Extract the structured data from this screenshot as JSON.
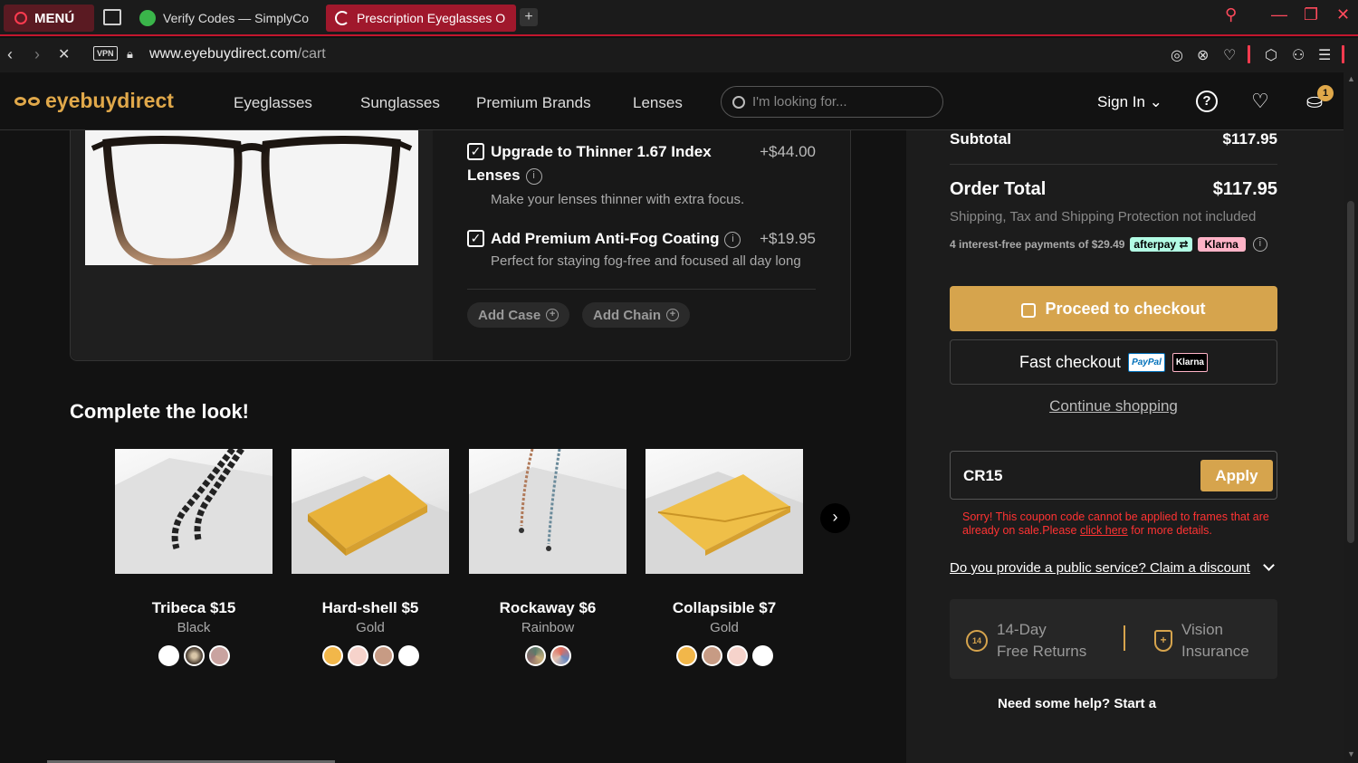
{
  "browser": {
    "menu_label": "MENÚ",
    "tabs": [
      {
        "title": "Verify Codes — SimplyCo",
        "active": false
      },
      {
        "title": "Prescription Eyeglasses O",
        "active": true
      }
    ],
    "new_tab": "+",
    "url_domain": "www.eyebuydirect.com",
    "url_path": "/cart",
    "vpn_label": "VPN"
  },
  "header": {
    "logo": "eyebuydirect",
    "nav": [
      "Eyeglasses",
      "Sunglasses",
      "Premium Brands",
      "Lenses"
    ],
    "search_placeholder": "I'm looking for...",
    "sign_in": "Sign In",
    "cart_count": "1"
  },
  "product_options": [
    {
      "title": "Upgrade to Thinner 1.67 Index",
      "title2": "Lenses",
      "price": "+$44.00",
      "desc": "Make your lenses thinner with extra focus.",
      "checked": true
    },
    {
      "title": "Add Premium Anti-Fog Coating",
      "price": "+$19.95",
      "desc": "Perfect for staying fog-free and focused all day long",
      "checked": true
    }
  ],
  "addons": [
    "Add Case",
    "Add Chain"
  ],
  "complete_look": {
    "title": "Complete the look!",
    "items": [
      {
        "name": "Tribeca $15",
        "color": "Black",
        "swatches": [
          "#ffffff",
          "#5a4a3e",
          "#c9a3a0"
        ]
      },
      {
        "name": "Hard-shell $5",
        "color": "Gold",
        "swatches": [
          "#f2b74a",
          "#f6d3cb",
          "#c79b84",
          "#ffffff"
        ]
      },
      {
        "name": "Rockaway $6",
        "color": "Rainbow",
        "swatches": [
          "#7e8e7a",
          "#e06c5c"
        ]
      },
      {
        "name": "Collapsible $7",
        "color": "Gold",
        "swatches": [
          "#f2b74a",
          "#c79b84",
          "#f6d3cb",
          "#ffffff"
        ]
      }
    ]
  },
  "summary": {
    "subtotal_label": "Subtotal",
    "subtotal_value": "$117.95",
    "order_total_label": "Order Total",
    "order_total_value": "$117.95",
    "shipping_note": "Shipping, Tax and Shipping Protection not included",
    "installments": "4 interest-free payments of $29.49",
    "afterpay": "afterpay",
    "klarna": "Klarna",
    "checkout_label": "Proceed to checkout",
    "fast_checkout_label": "Fast checkout",
    "paypal": "PayPal",
    "klarna_small": "Klarna",
    "continue_label": "Continue shopping",
    "coupon_value": "CR15",
    "apply_label": "Apply",
    "coupon_error_a": "Sorry! This coupon code cannot be applied to frames that are already on sale.Please",
    "coupon_error_link": "click here",
    "coupon_error_b": "for more details.",
    "public_service": "Do you provide a public service? Claim a discount",
    "benefit1_line1": "14-Day",
    "benefit1_line2": "Free Returns",
    "benefit1_icon": "14",
    "benefit2_line1": "Vision",
    "benefit2_line2": "Insurance",
    "help_text": "Need some help? Start a"
  },
  "colors": {
    "accent": "#d6a44d",
    "brand": "#e0a84a",
    "error": "#ff3333",
    "opera_red": "#c3162e"
  }
}
